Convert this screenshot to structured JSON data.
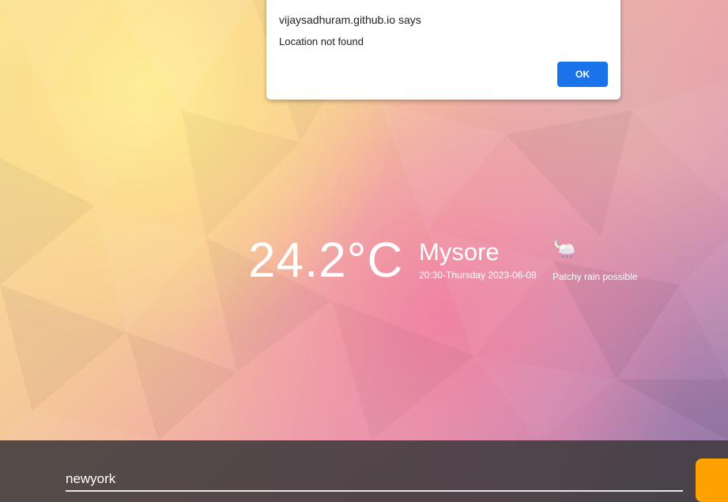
{
  "weather": {
    "temperature": "24.2°C",
    "city": "Mysore",
    "datetime": "20:30-Thursday 2023-06-08",
    "condition": "Patchy rain possible",
    "condition_icon": "night-cloud-rain-icon"
  },
  "search": {
    "value": "newyork"
  },
  "dialog": {
    "title": "vijaysadhuram.github.io says",
    "message": "Location not found",
    "ok_label": "OK"
  },
  "colors": {
    "footer_bar": "#3e3a3c",
    "search_button": "#ffa100",
    "dialog_button": "#1a73e8"
  }
}
